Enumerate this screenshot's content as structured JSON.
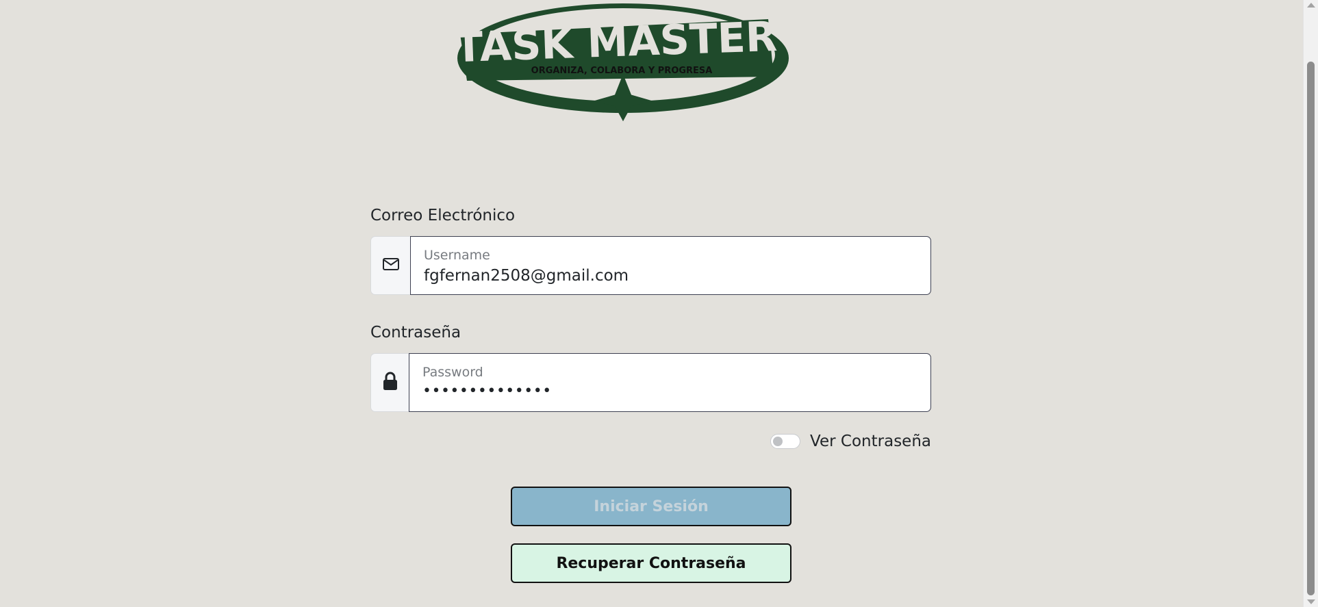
{
  "logo": {
    "title": "TASK MASTER",
    "tagline": "ORGANIZA, COLABORA Y PROGRESA"
  },
  "email": {
    "label": "Correo Electrónico",
    "placeholder": "Username",
    "value": "fgfernan2508@gmail.com",
    "icon": "envelope-icon"
  },
  "password": {
    "label": "Contraseña",
    "placeholder": "Password",
    "value": "••••••••••••••",
    "icon": "lock-icon"
  },
  "show_password": {
    "label": "Ver Contraseña",
    "checked": false
  },
  "buttons": {
    "login": "Iniciar Sesión",
    "recover": "Recuperar Contraseña"
  },
  "colors": {
    "background": "#e3e1dc",
    "logo": "#1f4a2b",
    "login_button": "#89b5cb",
    "recover_button": "#d8f4e4"
  }
}
